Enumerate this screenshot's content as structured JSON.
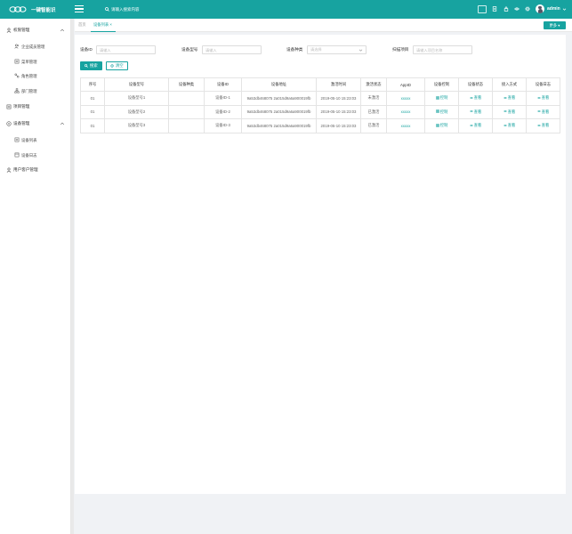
{
  "header": {
    "brand": "一键智能识",
    "search_placeholder": "请输入搜索内容",
    "box_label": "",
    "user_name": "admin",
    "accent": "#17a3a0"
  },
  "sidebar": {
    "groups": [
      {
        "label": "权限管理",
        "icon": "key-icon",
        "items": [
          {
            "label": "企业成员管理",
            "icon": "users-icon"
          },
          {
            "label": "菜单管理",
            "icon": "menu-icon"
          },
          {
            "label": "角色管理",
            "icon": "role-icon"
          },
          {
            "label": "部门管理",
            "icon": "org-icon"
          }
        ]
      },
      {
        "label": "项目管理",
        "icon": "project-icon",
        "items": []
      },
      {
        "label": "设备管理",
        "icon": "device-icon",
        "items": [
          {
            "label": "设备列表",
            "icon": "list-icon"
          },
          {
            "label": "设备日志",
            "icon": "log-icon"
          }
        ]
      },
      {
        "label": "用户客户管理",
        "icon": "user-icon",
        "items": []
      }
    ]
  },
  "tabs": {
    "home": "首页",
    "active": "设备列表",
    "more": "更多"
  },
  "filters": {
    "device_id_label": "设备ID",
    "device_id_placeholder": "请输入",
    "device_model_label": "设备型号",
    "device_model_placeholder": "请输入",
    "device_type_label": "设备种类",
    "device_type_placeholder": "请选择",
    "scan_project_label": "扫描项目",
    "scan_project_placeholder": "请输入项目名称",
    "search_button": "搜索",
    "clear_button": "清空"
  },
  "table": {
    "headers": [
      "序号",
      "设备型号",
      "设备种类",
      "设备ID",
      "设备地址",
      "激活时间",
      "激活状态",
      "AppID",
      "设备控制",
      "设备状态",
      "接入方式",
      "设备日志"
    ],
    "rows": [
      {
        "no": "01",
        "model": "设备型号1",
        "type": "",
        "id": "设备ID-1",
        "addr": "9a53db468075 2a015d9a6a900019fb",
        "time": "2019-05-10 15:23:03",
        "status": "未激活",
        "appid": "xxxxx",
        "control": "控制",
        "dev_status": "查看",
        "access": "查看",
        "log": "查看"
      },
      {
        "no": "01",
        "model": "设备型号2",
        "type": "",
        "id": "设备ID-2",
        "addr": "9a53db468075 2a015d9a6a900019fb",
        "time": "2019-05-10 15:23:03",
        "status": "已激活",
        "appid": "xxxxx",
        "control": "控制",
        "dev_status": "查看",
        "access": "查看",
        "log": "查看"
      },
      {
        "no": "01",
        "model": "设备型号3",
        "type": "",
        "id": "设备ID-3",
        "addr": "9a53db468075 2a015d9a6a900019fb",
        "time": "2019-05-10 15:23:03",
        "status": "已激活",
        "appid": "xxxxx",
        "control": "控制",
        "dev_status": "查看",
        "access": "查看",
        "log": "查看"
      }
    ]
  }
}
